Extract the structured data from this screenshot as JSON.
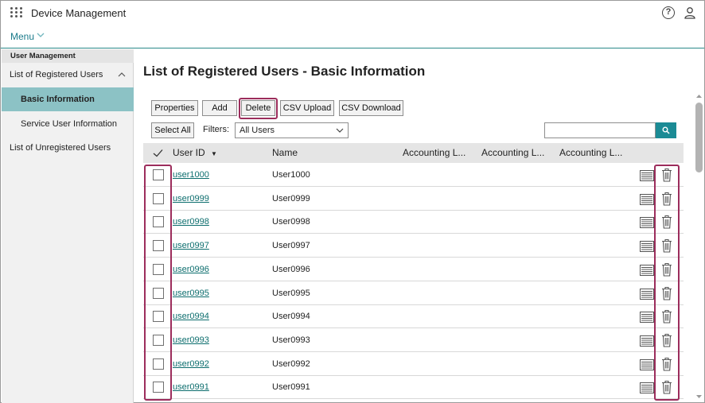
{
  "header": {
    "title": "Device Management",
    "menu_label": "Menu",
    "icons": [
      "apps-grid-icon",
      "help-icon",
      "user-icon"
    ]
  },
  "sidebar": {
    "group_label": "User Management",
    "items": [
      {
        "label": "List of Registered Users",
        "expanded": true
      },
      {
        "label": "Basic Information",
        "active": true
      },
      {
        "label": "Service User Information"
      },
      {
        "label": "List of Unregistered Users"
      }
    ]
  },
  "main": {
    "title": "List of Registered Users - Basic Information",
    "buttons": {
      "properties": "Properties",
      "add": "Add",
      "delete": "Delete",
      "csv_upload": "CSV Upload",
      "csv_download": "CSV Download",
      "select_all": "Select All"
    },
    "filters_label": "Filters:",
    "filter_value": "All Users",
    "search_value": ""
  },
  "table": {
    "columns": {
      "user_id": "User ID",
      "name": "Name",
      "acc1": "Accounting L...",
      "acc2": "Accounting L...",
      "acc3": "Accounting L..."
    },
    "sort_indicator": "▼",
    "rows": [
      {
        "id": "user1000",
        "name": "User1000"
      },
      {
        "id": "user0999",
        "name": "User0999"
      },
      {
        "id": "user0998",
        "name": "User0998"
      },
      {
        "id": "user0997",
        "name": "User0997"
      },
      {
        "id": "user0996",
        "name": "User0996"
      },
      {
        "id": "user0995",
        "name": "User0995"
      },
      {
        "id": "user0994",
        "name": "User0994"
      },
      {
        "id": "user0993",
        "name": "User0993"
      },
      {
        "id": "user0992",
        "name": "User0992"
      },
      {
        "id": "user0991",
        "name": "User0991"
      }
    ]
  },
  "colors": {
    "accent": "#1b8b95",
    "active_nav": "#8cc2c5",
    "highlight": "#9c2d5c",
    "link": "#0d6e6e"
  }
}
